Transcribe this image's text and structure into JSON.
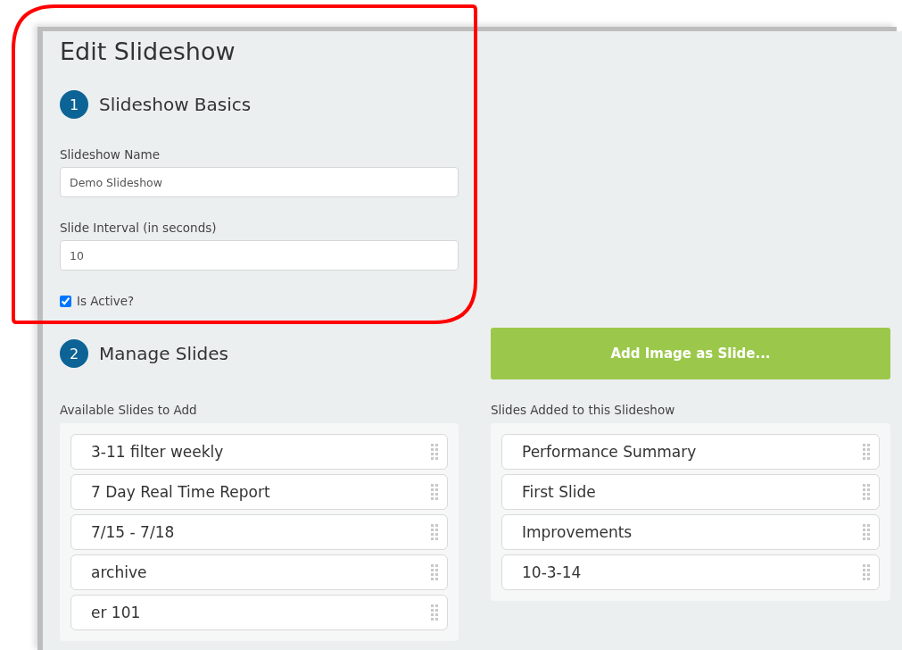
{
  "page": {
    "title": "Edit Slideshow"
  },
  "basics": {
    "step": "1",
    "heading": "Slideshow Basics",
    "fields": [
      {
        "label": "Slideshow Name",
        "value": "Demo Slideshow"
      },
      {
        "label": "Slide Interval (in seconds)",
        "value": "10"
      }
    ],
    "active": {
      "label": "Is Active?",
      "checked": true
    }
  },
  "slides": {
    "step": "2",
    "heading": "Manage Slides",
    "add_button": "Add Image as Slide...",
    "available": {
      "label": "Available Slides to Add",
      "items": [
        "3-11 filter weekly",
        "7 Day Real Time Report",
        "7/15 - 7/18",
        "archive",
        "er 101"
      ]
    },
    "added": {
      "label": "Slides Added to this Slideshow",
      "items": [
        "Performance Summary",
        "First Slide",
        "Improvements",
        "10-3-14"
      ]
    }
  }
}
